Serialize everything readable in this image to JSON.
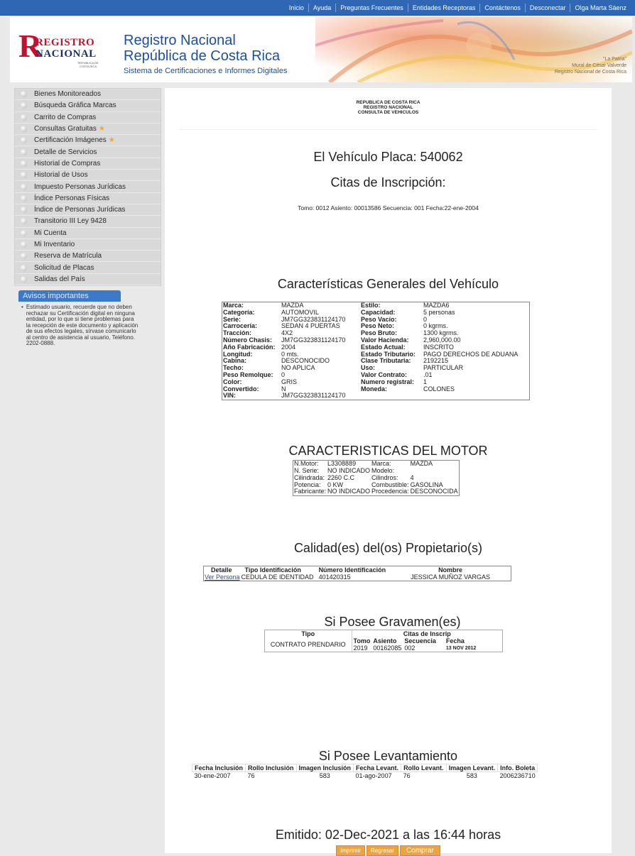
{
  "nav": [
    "Inicio",
    "Ayuda",
    "Preguntas Frecuentes",
    "Entidades Receptoras",
    "Contáctenos",
    "Desconectar",
    "Olga Marta Sáenz"
  ],
  "header": {
    "logo_line1": "REGISTRO",
    "logo_line2": "NACIONAL",
    "logo_small": "REPUBLICA DE COSTA RICA",
    "title1": "Registro Nacional",
    "title2": "República de Costa Rica",
    "subtitle": "Sistema de Certificaciones e Informes Digitales",
    "mural_caption": [
      "\"La Patria\"",
      "Mural de César Valverde",
      "Registro Nacional de Costa Rica"
    ]
  },
  "sidebar": {
    "items": [
      {
        "label": "Bienes Monitoreados",
        "star": false
      },
      {
        "label": "Búsqueda Gráfica Marcas",
        "star": false
      },
      {
        "label": "Carrito de Compras",
        "star": false
      },
      {
        "label": "Consultas Gratuitas",
        "star": true
      },
      {
        "label": "Certificación Imágenes",
        "star": true
      },
      {
        "label": "Detalle de Servicios",
        "star": false
      },
      {
        "label": "Historial de Compras",
        "star": false
      },
      {
        "label": "Historial de Usos",
        "star": false
      },
      {
        "label": "Impuesto Personas Jurídicas",
        "star": false
      },
      {
        "label": "Índice Personas Físicas",
        "star": false
      },
      {
        "label": "Índice de Personas Jurídicas",
        "star": false
      },
      {
        "label": "Transitorio III Ley 9428",
        "star": false
      },
      {
        "label": "Mi Cuenta",
        "star": false
      },
      {
        "label": "Mi Inventario",
        "star": false
      },
      {
        "label": "Reserva de Matrícula",
        "star": false
      },
      {
        "label": "Solicitud de Placas",
        "star": false
      },
      {
        "label": "Salidas del País",
        "star": false
      }
    ],
    "avisos_title": "Avisos importantes",
    "avisos_text": "Estimado usuario, recuerde que no deben rechazar su Certificación digital en ninguna entidad, por lo que si tiene problemas para la recepción de este documento y aplicación de sus efectos legales, sírvase comunicarlo al centro de asistencia al usuario, Teléfono. 2202-0888."
  },
  "doc": {
    "head": [
      "REPUBLICA DE COSTA RICA",
      "REGISTRO NACIONAL",
      "CONSULTA DE VEHICULOS"
    ],
    "title": "El Vehículo Placa: 540062",
    "citas_title": "Citas de Inscripción:",
    "citas_text": "Tomo: 0012 Asiento: 00013586 Secuencia: 001 Fecha:22-ene-2004",
    "caract_title": "Características Generales del Vehículo",
    "caract_left": [
      [
        "Marca:",
        "MAZDA"
      ],
      [
        "Categoría:",
        "AUTOMOVIL"
      ],
      [
        "Serie:",
        "JM7GG323831124170"
      ],
      [
        "Carrocería:",
        "SEDAN 4 PUERTAS"
      ],
      [
        "Tracción:",
        "4X2"
      ],
      [
        "Número Chasis:",
        "JM7GG323831124170"
      ],
      [
        "Año Fabricación:",
        "2004"
      ],
      [
        "Longitud:",
        "0 mts."
      ],
      [
        "Cabina:",
        "DESCONOCIDO"
      ],
      [
        "Techo:",
        "NO APLICA"
      ],
      [
        "Peso Remolque:",
        "0"
      ],
      [
        "Color:",
        "GRIS"
      ],
      [
        "Convertido:",
        "N"
      ],
      [
        "VIN:",
        "JM7GG323831124170"
      ]
    ],
    "caract_right": [
      [
        "Estilo:",
        "MAZDA6"
      ],
      [
        "Capacidad:",
        "5 personas"
      ],
      [
        "Peso Vacío:",
        "0"
      ],
      [
        "Peso Neto:",
        "0 kgrms."
      ],
      [
        "Peso Bruto:",
        "1300 kgrms."
      ],
      [
        "Valor Hacienda:",
        "2,960,000.00"
      ],
      [
        "Estado Actual:",
        "INSCRITO"
      ],
      [
        "Estado Tributario:",
        "PAGO DERECHOS DE ADUANA"
      ],
      [
        "Clase Tributaria:",
        "2192215"
      ],
      [
        "Uso:",
        "PARTICULAR"
      ],
      [
        "Valor Contrato:",
        ".01"
      ],
      [
        "Numero registral:",
        "1"
      ],
      [
        "Moneda:",
        "COLONES"
      ]
    ],
    "motor_title": "CARACTERISTICAS DEL MOTOR",
    "motor_left": [
      [
        "N.Motor:",
        "L3308889"
      ],
      [
        "N. Serie:",
        "NO INDICADO"
      ],
      [
        "Cilindrada:",
        "2260 C.C"
      ],
      [
        "Potencia:",
        "0 KW"
      ],
      [
        "Fabricante:",
        "NO INDICADO"
      ]
    ],
    "motor_right": [
      [
        "Marca:",
        "MAZDA"
      ],
      [
        "Modelo:",
        ""
      ],
      [
        "Cilindros:",
        "4"
      ],
      [
        "Combustible:",
        "GASOLINA"
      ],
      [
        "Procedencia:",
        "DESCONOCIDA"
      ]
    ],
    "prop_title": "Calidad(es) del(os) Propietario(s)",
    "prop_headers": [
      "Detalle",
      "Tipo Identificación",
      "Número Identificación",
      "Nombre"
    ],
    "prop_row": {
      "link": "Ver Persona",
      "tipo": "CEDULA DE IDENTIDAD",
      "numero": "401420315",
      "nombre": "JESSICA MUÑOZ VARGAS"
    },
    "grav_title": "Si Posee Gravamen(es)",
    "grav_headers": {
      "tipo": "Tipo",
      "citas": "Citas de Inscrip",
      "tomo": "Tomo",
      "asiento": "Asiento",
      "secuencia": "Secuencia",
      "fecha": "Fecha"
    },
    "grav_row": {
      "tipo": "CONTRATO PRENDARIO",
      "tomo": "2019",
      "asiento": "00162085",
      "secuencia": "002",
      "fecha": "13 NOV 2012"
    },
    "lev_title": "Si Posee Levantamiento",
    "lev_headers": [
      "Fecha Inclusión",
      "Rollo Inclusión",
      "Imagen Inclusión",
      "Fecha Levant.",
      "Rollo Levant.",
      "Imagen Levant.",
      "Info. Boleta"
    ],
    "lev_row": [
      "30-ene-2007",
      "76",
      "583",
      "01-ago-2007",
      "76",
      "583",
      "2006236710"
    ],
    "emitido": "Emitido: 02-Dec-2021 a las 16:44 horas",
    "buttons": [
      "Imprimir",
      "Regresar",
      "Comprar"
    ]
  }
}
